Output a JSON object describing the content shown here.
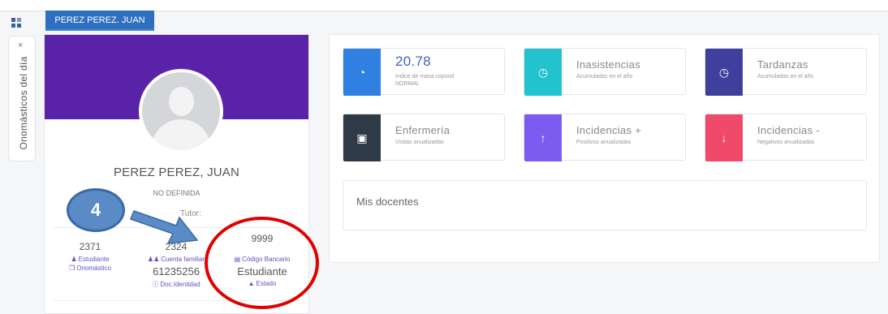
{
  "app": {
    "tab_label": "PEREZ PEREZ. JUAN",
    "side_rail_label": "Onomásticos del día",
    "side_rail_close": "×"
  },
  "profile": {
    "name": "PEREZ PEREZ, JUAN",
    "status": "NO DEFINIDA",
    "tutor_label": "Tutor:",
    "stats": [
      {
        "value": "2371",
        "label": "Estudiante",
        "icon": "user-icon"
      },
      {
        "value": "2324",
        "label": "Cuenta familiar",
        "icon": "users-icon"
      },
      {
        "value": "9999",
        "label": "Código Bancario",
        "icon": "credit-card-icon"
      }
    ],
    "stats_row2": [
      {
        "value": "",
        "label": "Onomástico",
        "icon": "gift-icon"
      },
      {
        "value": "61235256",
        "label": "Doc.Identidad",
        "icon": "info-circle-icon"
      },
      {
        "value": "Estudiante",
        "label": "Estado",
        "icon": "graduation-cap-icon"
      }
    ]
  },
  "annotation": {
    "step_number": "4"
  },
  "tiles": [
    {
      "title": "20.78",
      "sub": "Indice de masa coporal",
      "sub2": "NORMAL",
      "icon": "pie-chart-icon",
      "color": "#2f80e0"
    },
    {
      "title": "Inasistencias",
      "sub": "Acumuladas en el año",
      "sub2": "",
      "icon": "clock-icon",
      "color": "#22c2cf"
    },
    {
      "title": "Tardanzas",
      "sub": "Acumuladas en el año",
      "sub2": "",
      "icon": "clock-icon",
      "color": "#3f3f9e"
    },
    {
      "title": "Enfermería",
      "sub": "Visitas anualizadas",
      "sub2": "",
      "icon": "image-icon",
      "color": "#2e3a45"
    },
    {
      "title": "Incidencias +",
      "sub": "Positivos anualizadas",
      "sub2": "",
      "icon": "arrow-up-icon",
      "color": "#7c5cf0"
    },
    {
      "title": "Incidencias -",
      "sub": "Negativos anualizadas",
      "sub2": "",
      "icon": "arrow-down-icon",
      "color": "#f04a6a"
    }
  ],
  "docentes": {
    "title": "Mis docentes"
  }
}
